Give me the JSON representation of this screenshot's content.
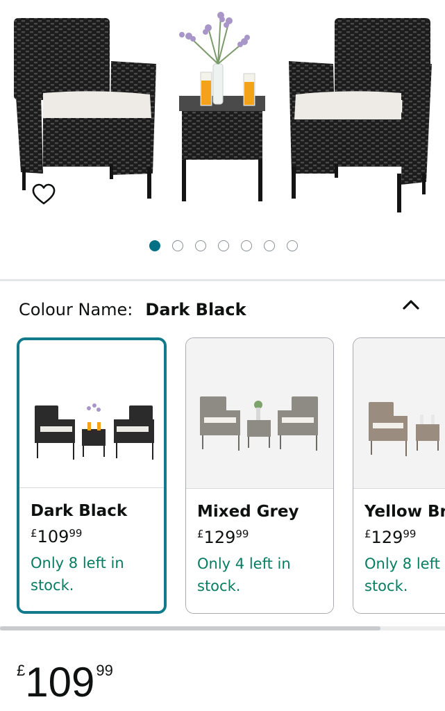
{
  "product_image": {
    "alt": "",
    "carousel": {
      "total": 7,
      "active": 0
    }
  },
  "icons": {
    "wishlist": "heart-icon",
    "collapse": "chevron-up-icon"
  },
  "colour": {
    "label": "Colour Name:",
    "value": "Dark Black"
  },
  "swatches": [
    {
      "name": "Dark Black",
      "currency": "£",
      "price_whole": "109",
      "price_pence": "99",
      "stock_line1": "Only 8 left in",
      "stock_line2": "stock.",
      "selected": true
    },
    {
      "name": "Mixed Grey",
      "currency": "£",
      "price_whole": "129",
      "price_pence": "99",
      "stock_line1": "Only 4 left in",
      "stock_line2": "stock.",
      "selected": false
    },
    {
      "name": "Yellow Br",
      "currency": "£",
      "price_whole": "129",
      "price_pence": "99",
      "stock_line1": "Only 8 left",
      "stock_line2": "stock.",
      "selected": false
    }
  ],
  "price": {
    "currency": "£",
    "whole": "109",
    "pence": "99"
  },
  "colors": {
    "accent": "#007185",
    "selected_border": "#127a8a",
    "stock_green": "#067d62"
  }
}
